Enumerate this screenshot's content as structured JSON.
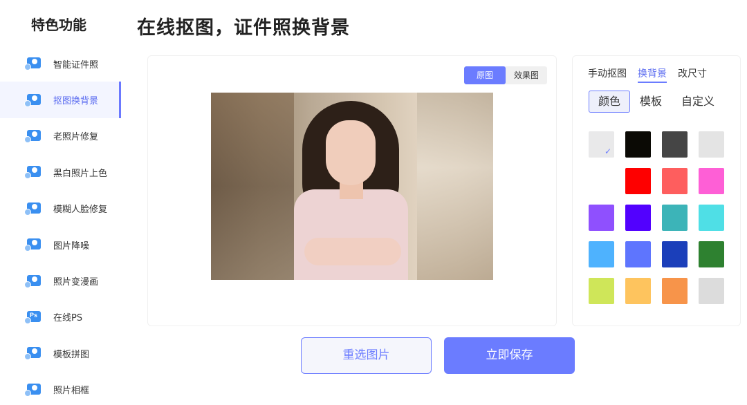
{
  "sidebar": {
    "title": "特色功能",
    "items": [
      {
        "label": "智能证件照",
        "icon": "id-photo-icon",
        "active": false
      },
      {
        "label": "抠图换背景",
        "icon": "cutout-icon",
        "active": true
      },
      {
        "label": "老照片修复",
        "icon": "old-photo-repair-icon",
        "active": false
      },
      {
        "label": "黑白照片上色",
        "icon": "colorize-icon",
        "active": false
      },
      {
        "label": "模糊人脸修复",
        "icon": "face-repair-icon",
        "active": false
      },
      {
        "label": "图片降噪",
        "icon": "denoise-icon",
        "active": false
      },
      {
        "label": "照片变漫画",
        "icon": "cartoon-icon",
        "active": false
      },
      {
        "label": "在线PS",
        "icon": "ps-icon",
        "icon_text": "Ps",
        "active": false
      },
      {
        "label": "模板拼图",
        "icon": "puzzle-icon",
        "active": false
      },
      {
        "label": "照片相框",
        "icon": "frame-icon",
        "active": false
      }
    ]
  },
  "header": {
    "title": "在线抠图，证件照换背景"
  },
  "preview": {
    "toggle": [
      {
        "label": "原图",
        "active": true
      },
      {
        "label": "效果图",
        "active": false
      }
    ]
  },
  "actions": {
    "reselect_label": "重选图片",
    "save_label": "立即保存"
  },
  "panel": {
    "tabs": [
      {
        "label": "手动抠图",
        "active": false
      },
      {
        "label": "换背景",
        "active": true
      },
      {
        "label": "改尺寸",
        "active": false
      }
    ],
    "subtabs": [
      {
        "label": "颜色",
        "active": true
      },
      {
        "label": "模板",
        "active": false
      },
      {
        "label": "自定义",
        "active": false
      }
    ],
    "colors": [
      {
        "color": "#e9e9ea",
        "selected": true
      },
      {
        "color": "#0b0a05",
        "selected": false
      },
      {
        "color": "#454545",
        "selected": false
      },
      {
        "color": "#e4e4e4",
        "selected": false
      },
      {
        "color": "#ffffff",
        "selected": false
      },
      {
        "color": "#fe0000",
        "selected": false
      },
      {
        "color": "#fe5e5e",
        "selected": false
      },
      {
        "color": "#fe5fd6",
        "selected": false
      },
      {
        "color": "#8f50fe",
        "selected": false
      },
      {
        "color": "#5201fe",
        "selected": false
      },
      {
        "color": "#3cb4b8",
        "selected": false
      },
      {
        "color": "#4fdfe6",
        "selected": false
      },
      {
        "color": "#4eb2fe",
        "selected": false
      },
      {
        "color": "#5e75fe",
        "selected": false
      },
      {
        "color": "#1b3fba",
        "selected": false
      },
      {
        "color": "#2e8130",
        "selected": false
      },
      {
        "color": "#cfe659",
        "selected": false
      },
      {
        "color": "#fec45e",
        "selected": false
      },
      {
        "color": "#f7944a",
        "selected": false
      },
      {
        "color": "#dcdcdc",
        "selected": false
      }
    ]
  }
}
